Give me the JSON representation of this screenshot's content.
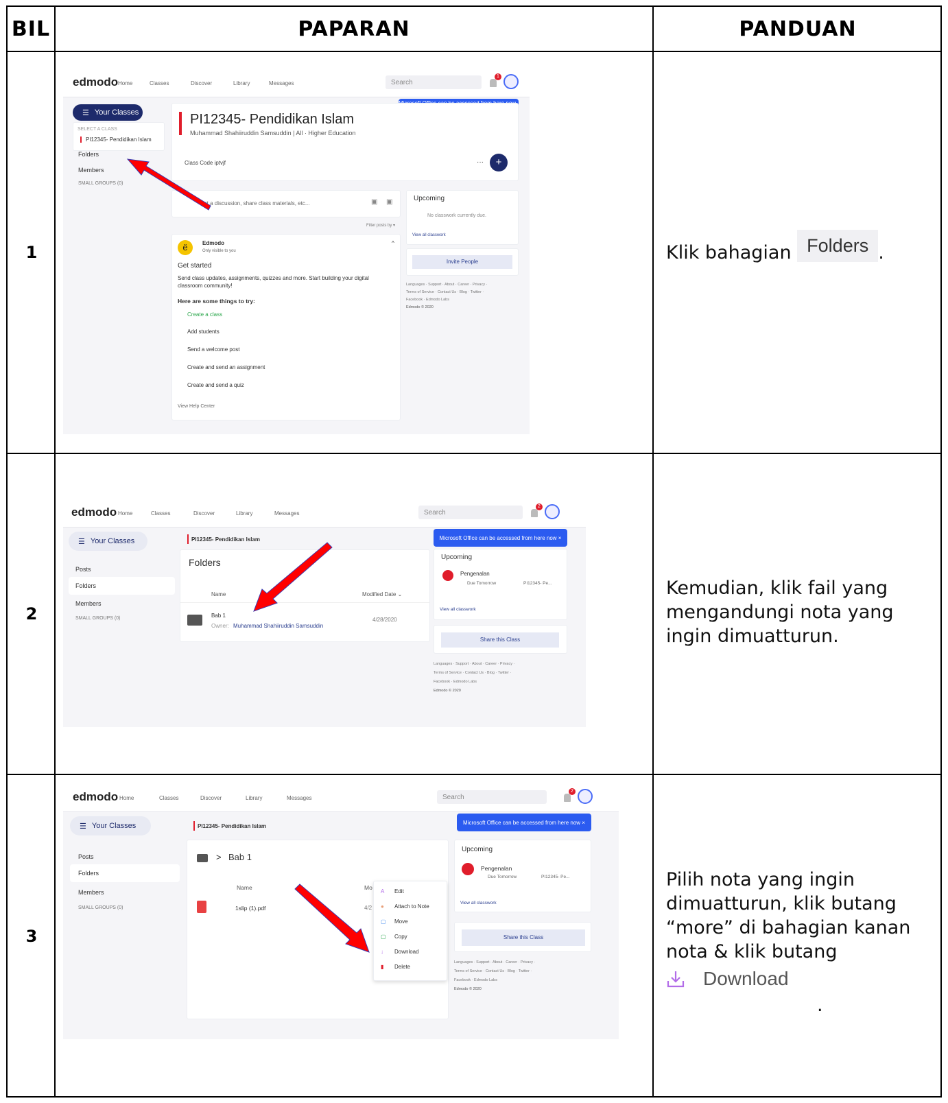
{
  "table": {
    "headers": {
      "bil": "BIL",
      "paparan": "PAPARAN",
      "panduan": "PANDUAN"
    },
    "rows": [
      {
        "num": "1",
        "guide_text": "Klik bahagian",
        "guide_chip": "Folders",
        "guide_end": "."
      },
      {
        "num": "2",
        "guide_text": "Kemudian, klik fail yang mengandungi nota yang ingin dimuatturun."
      },
      {
        "num": "3",
        "guide_text": "Pilih nota yang ingin dimuatturun, klik butang “more” di bahagian kanan nota & klik butang",
        "guide_chip": "Download",
        "guide_end": "."
      }
    ]
  },
  "app": {
    "logo": "edmodo",
    "nav": [
      "Home",
      "Classes",
      "Discover",
      "Library",
      "Messages"
    ],
    "search_placeholder": "Search",
    "toast": "Microsoft Office can be accessed from here now ×",
    "your_classes": "Your Classes",
    "colors": {
      "accent": "#2b5bf0",
      "navy": "#1d2a6b",
      "red": "#e01d2b",
      "arrow": "#ff0000"
    }
  },
  "shot1": {
    "badge": "1",
    "select_a_class": "SELECT A CLASS",
    "class_item": "PI12345- Pendidikan Islam",
    "folders": "Folders",
    "members": "Members",
    "small_groups": "SMALL GROUPS (0)",
    "class_title": "PI12345- Pendidikan Islam",
    "class_subtitle": "Muhammad Shahiiruddin Samsuddin | All · Higher Education",
    "class_code": "Class Code iptvjf",
    "compose": "rt a discussion, share class materials, etc...",
    "filter": "Filter posts by ▾",
    "upcoming": "Upcoming",
    "no_classwork": "No classwork currently due.",
    "view_all": "View all classwork",
    "invite": "Invite People",
    "footer": [
      "Languages · Support · About · Career · Privacy ·",
      "Terms of Service · Contact Us · Blog · Twitter ·",
      "Facebook · Edmodo Labs",
      "Edmodo © 2020"
    ],
    "post_author": "Edmodo",
    "post_visibility": "Only visible to you",
    "get_started": "Get started",
    "post_body": "Send class updates, assignments, quizzes and more. Start building your digital classroom community!",
    "things_heading": "Here are some things to try:",
    "things": [
      "Create a class",
      "Add students",
      "Send a welcome post",
      "Create and send an assignment",
      "Create and send a quiz"
    ],
    "help": "View Help Center"
  },
  "shot2": {
    "badge": "2",
    "posts": "Posts",
    "folders": "Folders",
    "members": "Members",
    "small_groups": "SMALL GROUPS (0)",
    "breadcrumb": "PI12345- Pendidikan Islam",
    "folders_title": "Folders",
    "col_name": "Name",
    "col_modified": "Modified Date ⌄",
    "folder_name": "Bab 1",
    "owner_label": "Owner:",
    "owner_name": "Muhammad Shahiiruddin Samsuddin",
    "folder_date": "4/28/2020",
    "upcoming": "Upcoming",
    "item": "Pengenalan",
    "due": "Due Tomorrow",
    "due_class": "PI12345- Pe...",
    "view_all": "View all classwork",
    "share": "Share this Class",
    "footer": [
      "Languages · Support · About · Career · Privacy ·",
      "Terms of Service · Contact Us · Blog · Twitter ·",
      "Facebook · Edmodo Labs",
      "Edmodo © 2020"
    ]
  },
  "shot3": {
    "badge": "2",
    "posts": "Posts",
    "folders": "Folders",
    "members": "Members",
    "small_groups": "SMALL GROUPS (0)",
    "breadcrumb": "PI12345- Pendidikan Islam",
    "path_sep": ">",
    "path_folder": "Bab 1",
    "col_name": "Name",
    "col_modified": "Mo",
    "file_name": "1slip (1).pdf",
    "file_date": "4/2",
    "menu": [
      "Edit",
      "Attach to Note",
      "Move",
      "Copy",
      "Download",
      "Delete"
    ],
    "upcoming": "Upcoming",
    "item": "Pengenalan",
    "due": "Due Tomorrow",
    "due_class": "PI12345- Pe...",
    "view_all": "View all classwork",
    "share": "Share this Class",
    "footer": [
      "Languages · Support · About · Career · Privacy ·",
      "Terms of Service · Contact Us · Blog · Twitter ·",
      "Facebook · Edmodo Labs",
      "Edmodo © 2020"
    ]
  }
}
